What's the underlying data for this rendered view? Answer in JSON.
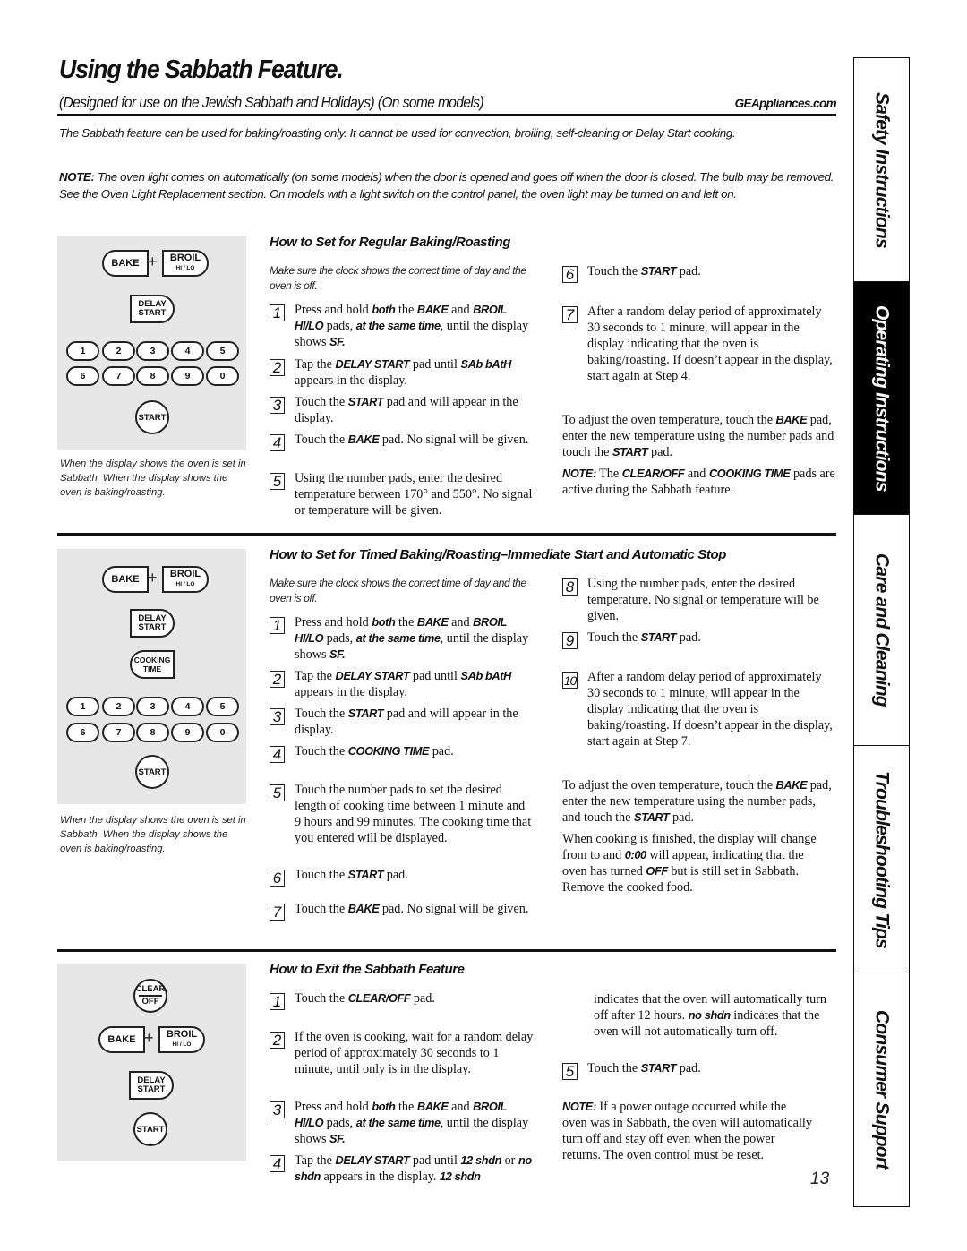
{
  "header": {
    "title": "Using the Sabbath Feature.",
    "subtitle": "(Designed for use on the Jewish Sabbath and Holidays)  (On some models)",
    "website": "GEAppliances.com"
  },
  "intro": {
    "paragraph": "The Sabbath feature can be used for baking/roasting only. It cannot be used for convection, broiling, self-cleaning or Delay Start cooking.",
    "note_label": "NOTE:",
    "note_text": " The oven light comes on automatically (on some models) when the door is opened and goes off when the door is closed. The bulb may be removed. See the Oven Light Replacement section. On models with a light switch on the control panel, the oven light may be turned on and left on."
  },
  "side_tabs": [
    {
      "label": "Safety Instructions",
      "active": false
    },
    {
      "label": "Operating Instructions",
      "active": true
    },
    {
      "label": "Care and Cleaning",
      "active": false
    },
    {
      "label": "Troubleshooting Tips",
      "active": false
    },
    {
      "label": "Consumer Support",
      "active": false
    }
  ],
  "keypad": {
    "bake": "BAKE",
    "broil": "BROIL",
    "broil_sub": "HI / LO",
    "plus": "+",
    "delay_1": "DELAY",
    "delay_2": "START",
    "cooking_1": "COOKING",
    "cooking_2": "TIME",
    "start": "START",
    "clear": "CLEAR",
    "off": "OFF",
    "numbers": [
      "1",
      "2",
      "3",
      "4",
      "5",
      "6",
      "7",
      "8",
      "9",
      "0"
    ]
  },
  "caption": "When the display shows     the oven is set in Sabbath. When the display shows          the oven is baking/roasting.",
  "section1": {
    "heading": "How to Set for Regular Baking/Roasting",
    "note": "Make sure the clock shows the correct time of day and the oven is off.",
    "steps": [
      {
        "n": "1",
        "parts": [
          "Press and hold ",
          "both",
          " the ",
          "BAKE",
          " and ",
          "BROIL HI/LO",
          " pads, ",
          "at the same time",
          ", until the display shows ",
          "SF."
        ]
      },
      {
        "n": "2",
        "parts": [
          "Tap the ",
          "DELAY START",
          " pad until ",
          "SAb bAtH",
          " appears in the display."
        ]
      },
      {
        "n": "3",
        "parts": [
          "Touch the ",
          "START",
          " pad and     will appear in the display."
        ]
      },
      {
        "n": "4",
        "parts": [
          "Touch the ",
          "BAKE",
          " pad. No signal will be given."
        ]
      },
      {
        "n": "5",
        "parts": [
          "Using the number pads, enter the desired temperature between 170° and 550°. No signal or temperature will be given."
        ]
      },
      {
        "n": "6",
        "parts": [
          "Touch the ",
          "START",
          " pad."
        ]
      },
      {
        "n": "7",
        "parts": [
          "After a random delay period of approximately 30 seconds to 1 minute,        will appear in the display indicating that the oven is baking/roasting. If      doesn’t appear in the display, start again at Step 4."
        ]
      }
    ],
    "adjust": [
      "To adjust the oven temperature, touch the ",
      "BAKE",
      " pad, enter the new temperature using the number pads and touch the ",
      "START",
      " pad."
    ],
    "note2": [
      "NOTE:",
      " The ",
      "CLEAR/OFF",
      " and ",
      "COOKING TIME",
      " pads are active during the Sabbath feature."
    ]
  },
  "section2": {
    "heading": "How to Set for Timed Baking/Roasting–Immediate Start and Automatic Stop",
    "note": "Make sure the clock shows the correct time of day and the oven is off.",
    "steps": [
      {
        "n": "1",
        "parts": [
          "Press and hold ",
          "both",
          " the ",
          "BAKE",
          " and ",
          "BROIL HI/LO",
          " pads, ",
          "at the same time",
          ", until the display shows ",
          "SF."
        ]
      },
      {
        "n": "2",
        "parts": [
          "Tap the ",
          "DELAY START",
          " pad until ",
          "SAb bAtH",
          " appears in the display."
        ]
      },
      {
        "n": "3",
        "parts": [
          "Touch the ",
          "START",
          " pad and     will appear in the display."
        ]
      },
      {
        "n": "4",
        "parts": [
          "Touch the ",
          "COOKING TIME",
          " pad."
        ]
      },
      {
        "n": "5",
        "parts": [
          "Touch the number pads to set the desired length of cooking time between 1 minute and 9 hours and 99 minutes. The cooking time that you entered will be displayed."
        ]
      },
      {
        "n": "6",
        "parts": [
          "Touch the ",
          "START",
          " pad."
        ]
      },
      {
        "n": "7",
        "parts": [
          "Touch the ",
          "BAKE",
          " pad. No signal will be given."
        ]
      },
      {
        "n": "8",
        "parts": [
          "Using the number pads, enter the desired temperature. No signal or temperature will be given."
        ]
      },
      {
        "n": "9",
        "parts": [
          "Touch the ",
          "START",
          " pad."
        ]
      },
      {
        "n": "10",
        "parts": [
          "After a random delay period of approximately 30 seconds to 1 minute,        will appear in the display indicating that the oven is baking/roasting. If      doesn’t appear in the display, start again at Step 7."
        ]
      }
    ],
    "adjust": [
      "To adjust the oven temperature, touch the ",
      "BAKE",
      " pad, enter the new temperature using the number pads, and touch the ",
      "START",
      " pad."
    ],
    "finished": [
      "When cooking is finished, the display will change from          to     and ",
      "0:00",
      " will appear, indicating that the oven has turned ",
      "OFF",
      " but is still set in Sabbath. Remove the cooked food."
    ]
  },
  "section3": {
    "heading": "How to Exit the Sabbath Feature",
    "steps": [
      {
        "n": "1",
        "parts": [
          "Touch the ",
          "CLEAR/OFF",
          " pad."
        ]
      },
      {
        "n": "2",
        "parts": [
          "If the oven is cooking, wait for a random delay period of approximately 30 seconds to 1 minute, until only      is in the display."
        ]
      },
      {
        "n": "3",
        "parts": [
          "Press and hold ",
          "both",
          " the ",
          "BAKE",
          " and ",
          "BROIL HI/LO",
          " pads, ",
          "at the same time",
          ", until the display shows ",
          "SF."
        ]
      },
      {
        "n": "4",
        "parts": [
          "Tap the ",
          "DELAY START",
          " pad until ",
          "12 shdn",
          " or ",
          "no shdn",
          " appears in the display. ",
          "12 shdn",
          " indicates that the oven will automatically turn off after 12 hours. ",
          "no shdn",
          " indicates that the oven will not automatically turn off."
        ]
      },
      {
        "n": "5",
        "parts": [
          "Touch the ",
          "START",
          " pad."
        ]
      }
    ],
    "note": [
      "NOTE:",
      " If a power outage occurred while the oven was in Sabbath, the oven will automatically turn off and stay off even when the power returns. The oven control must be reset."
    ]
  },
  "page_number": "13"
}
